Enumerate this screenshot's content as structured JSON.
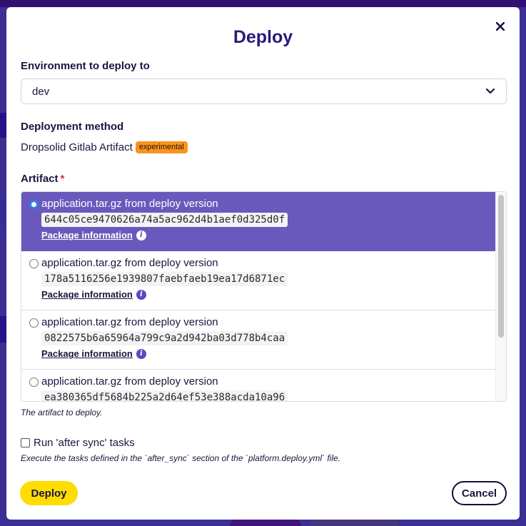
{
  "modal": {
    "title": "Deploy",
    "close_icon": "close-icon"
  },
  "environment": {
    "label": "Environment to deploy to",
    "selected": "dev"
  },
  "method": {
    "label": "Deployment method",
    "value": "Dropsolid Gitlab Artifact",
    "badge": "experimental"
  },
  "artifact": {
    "label": "Artifact",
    "required_marker": "*",
    "help": "The artifact to deploy.",
    "items": [
      {
        "title": "application.tar.gz from deploy version",
        "hash": "644c05ce9470626a74a5ac962d4b1aef0d325d0f",
        "link": "Package information",
        "selected": true
      },
      {
        "title": "application.tar.gz from deploy version",
        "hash": "178a5116256e1939807faebfaeb19ea17d6871ec",
        "link": "Package information",
        "selected": false
      },
      {
        "title": "application.tar.gz from deploy version",
        "hash": "0822575b6a65964a799c9a2d942ba03d778b4caa",
        "link": "Package information",
        "selected": false
      },
      {
        "title": "application.tar.gz from deploy version",
        "hash": "ea380365df5684b225a2d64ef53e388acda10a96",
        "link": "Package information",
        "selected": false
      }
    ]
  },
  "after_sync": {
    "label": "Run 'after sync' tasks",
    "checked": false,
    "help": "Execute the tasks defined in the `after_sync` section of the `platform.deploy.yml` file."
  },
  "buttons": {
    "deploy": "Deploy",
    "cancel": "Cancel"
  },
  "colors": {
    "accent": "#6a59bc",
    "primary_button": "#ffdd00",
    "badge": "#f7931e",
    "title": "#2a1a7c"
  }
}
